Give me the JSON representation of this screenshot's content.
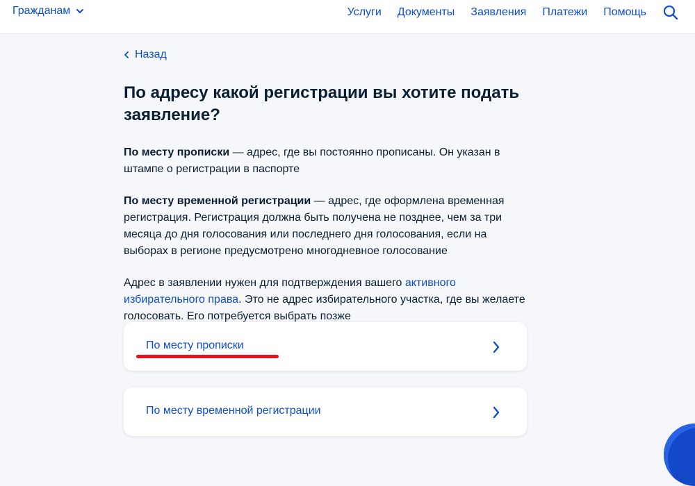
{
  "header": {
    "audience_label": "Гражданам",
    "nav": [
      "Услуги",
      "Документы",
      "Заявления",
      "Платежи",
      "Помощь"
    ]
  },
  "back_label": "Назад",
  "title": "По адресу какой регистрации вы хотите подать заявление?",
  "paragraphs": {
    "p1_bold": "По месту прописки",
    "p1_rest": " — адрес, где вы постоянно прописаны. Он указан в штампе о регистрации в паспорте",
    "p2_bold": "По месту временной регистрации",
    "p2_rest": " — адрес, где оформлена временная регистрация. Регистрация должна быть получена не позднее, чем за три месяца до дня голосования или последнего дня голосования, если на выборах в регионе предусмотрено многодневное голосование",
    "p3_start": "Адрес в заявлении нужен для подтверждения вашего ",
    "p3_link": "активного избирательного права",
    "p3_end": ". Это не адрес избирательного участка, где вы желаете голосовать. Его потребуется выбрать позже"
  },
  "options": [
    "По месту прописки",
    "По месту временной регистрации"
  ],
  "colors": {
    "accent": "#0d4cd3",
    "text": "#0b1f33",
    "background": "#f5f7fa",
    "highlight_underline": "#e0151f"
  }
}
